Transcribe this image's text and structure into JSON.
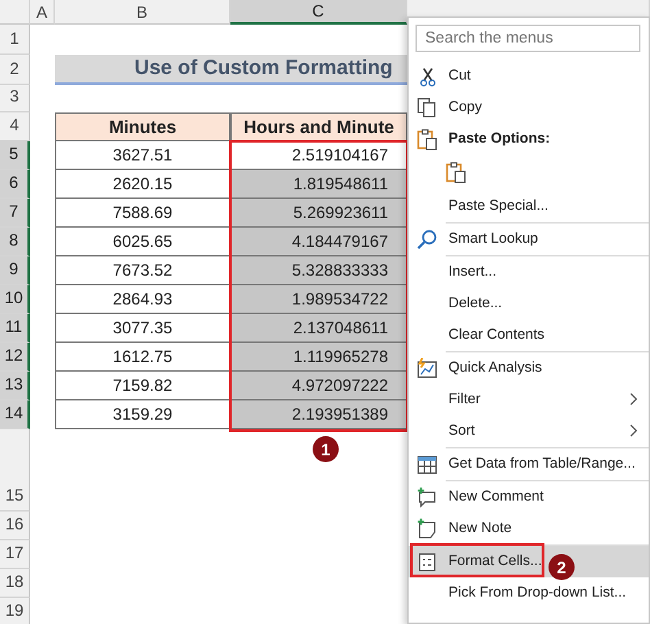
{
  "sheet": {
    "column_headers": [
      {
        "label": "A",
        "selected": false
      },
      {
        "label": "B",
        "selected": false
      },
      {
        "label": "C",
        "selected": true
      }
    ],
    "row_headers": [
      {
        "label": "1",
        "selected": false
      },
      {
        "label": "2",
        "selected": false
      },
      {
        "label": "3",
        "selected": false
      },
      {
        "label": "4",
        "selected": false
      },
      {
        "label": "5",
        "selected": true
      },
      {
        "label": "6",
        "selected": true
      },
      {
        "label": "7",
        "selected": true
      },
      {
        "label": "8",
        "selected": true
      },
      {
        "label": "9",
        "selected": true
      },
      {
        "label": "10",
        "selected": true
      },
      {
        "label": "11",
        "selected": true
      },
      {
        "label": "12",
        "selected": true
      },
      {
        "label": "13",
        "selected": true
      },
      {
        "label": "14",
        "selected": true
      },
      {
        "label": "15",
        "selected": false
      },
      {
        "label": "16",
        "selected": false
      },
      {
        "label": "17",
        "selected": false
      },
      {
        "label": "18",
        "selected": false
      },
      {
        "label": "19",
        "selected": false
      }
    ],
    "title": "Use of Custom Formatting",
    "table": {
      "columns": [
        "Minutes",
        "Hours and Minute"
      ],
      "rows": [
        {
          "minutes": "3627.51",
          "hours": "2.519104167",
          "selected": false
        },
        {
          "minutes": "2620.15",
          "hours": "1.819548611",
          "selected": true
        },
        {
          "minutes": "7588.69",
          "hours": "5.269923611",
          "selected": true
        },
        {
          "minutes": "6025.65",
          "hours": "4.184479167",
          "selected": true
        },
        {
          "minutes": "7673.52",
          "hours": "5.328833333",
          "selected": true
        },
        {
          "minutes": "2864.93",
          "hours": "1.989534722",
          "selected": true
        },
        {
          "minutes": "3077.35",
          "hours": "2.137048611",
          "selected": true
        },
        {
          "minutes": "1612.75",
          "hours": "1.119965278",
          "selected": true
        },
        {
          "minutes": "7159.82",
          "hours": "4.972097222",
          "selected": true
        },
        {
          "minutes": "3159.29",
          "hours": "2.193951389",
          "selected": true
        }
      ]
    }
  },
  "step_badges": [
    {
      "label": "1"
    },
    {
      "label": "2"
    }
  ],
  "context_menu": {
    "search": {
      "placeholder": "Search the menus"
    },
    "items": [
      {
        "kind": "command",
        "label": "Cut",
        "highlighted": false
      },
      {
        "kind": "command",
        "label": "Copy",
        "highlighted": false
      },
      {
        "kind": "header",
        "label": "Paste Options:"
      },
      {
        "kind": "paste-button"
      },
      {
        "kind": "command",
        "label": "Paste Special...",
        "highlighted": false
      },
      {
        "kind": "separator"
      },
      {
        "kind": "command",
        "label": "Smart Lookup",
        "highlighted": false
      },
      {
        "kind": "separator"
      },
      {
        "kind": "command",
        "label": "Insert...",
        "highlighted": false
      },
      {
        "kind": "command",
        "label": "Delete...",
        "highlighted": false
      },
      {
        "kind": "command",
        "label": "Clear Contents",
        "highlighted": false
      },
      {
        "kind": "separator"
      },
      {
        "kind": "command",
        "label": "Quick Analysis",
        "highlighted": false
      },
      {
        "kind": "submenu",
        "label": "Filter",
        "highlighted": false
      },
      {
        "kind": "submenu",
        "label": "Sort",
        "highlighted": false
      },
      {
        "kind": "separator"
      },
      {
        "kind": "command",
        "label": "Get Data from Table/Range...",
        "highlighted": false
      },
      {
        "kind": "separator"
      },
      {
        "kind": "command",
        "label": "New Comment",
        "highlighted": false
      },
      {
        "kind": "command",
        "label": "New Note",
        "highlighted": false
      },
      {
        "kind": "separator"
      },
      {
        "kind": "command",
        "label": "Format Cells...",
        "highlighted": true
      },
      {
        "kind": "command",
        "label": "Pick From Drop-down List...",
        "highlighted": false
      }
    ]
  }
}
